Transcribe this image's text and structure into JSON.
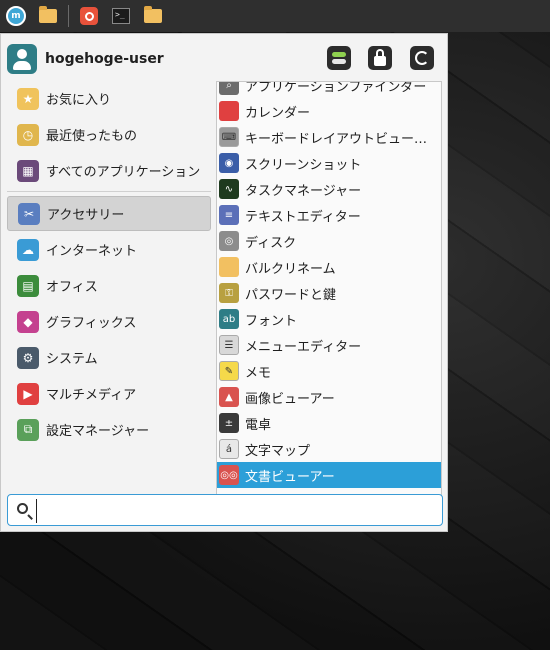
{
  "taskbar": {
    "items": [
      {
        "name": "menu-logo",
        "icon": "mint-logo-icon"
      },
      {
        "name": "files",
        "icon": "folder-icon"
      },
      {
        "name": "browser",
        "icon": "firefox-icon"
      },
      {
        "name": "terminal",
        "icon": "terminal-icon"
      },
      {
        "name": "folder",
        "icon": "folder-icon"
      }
    ]
  },
  "menu": {
    "user_name": "hogehoge-user",
    "header_buttons": {
      "settings_icon": "settings-toggle-icon",
      "lock_icon": "lock-icon",
      "logout_icon": "power-icon"
    },
    "categories": [
      {
        "label": "お気に入り",
        "icon": "favorites-icon",
        "color": "#f0c35c"
      },
      {
        "label": "最近使ったもの",
        "icon": "recent-icon",
        "color": "#e0b64d"
      },
      {
        "label": "すべてのアプリケーション",
        "icon": "grid-icon",
        "color": "#6b4a7a"
      },
      {
        "label": "アクセサリー",
        "icon": "scissors-icon",
        "color": "#5a7ec0",
        "active": true
      },
      {
        "label": "インターネット",
        "icon": "cloud-icon",
        "color": "#3a9bd5"
      },
      {
        "label": "オフィス",
        "icon": "office-icon",
        "color": "#3c8c3c"
      },
      {
        "label": "グラフィックス",
        "icon": "graphics-icon",
        "color": "#c4418f"
      },
      {
        "label": "システム",
        "icon": "gear-icon",
        "color": "#4a5a6a"
      },
      {
        "label": "マルチメディア",
        "icon": "play-icon",
        "color": "#e04040"
      },
      {
        "label": "設定マネージャー",
        "icon": "settings-icon",
        "color": "#5aa05a"
      }
    ],
    "apps": [
      {
        "label": "アプリケーションファインダー",
        "icon": "magnifier-icon",
        "color": "#6c6c6c"
      },
      {
        "label": "カレンダー",
        "icon": "calendar-icon",
        "color": "#e04040"
      },
      {
        "label": "キーボードレイアウトビュー…",
        "icon": "keyboard-icon",
        "color": "#9a9a9a"
      },
      {
        "label": "スクリーンショット",
        "icon": "camera-icon",
        "color": "#3b5ea8"
      },
      {
        "label": "タスクマネージャー",
        "icon": "pulse-icon",
        "color": "#1e3a1e"
      },
      {
        "label": "テキストエディター",
        "icon": "text-editor-icon",
        "color": "#5b6fb8"
      },
      {
        "label": "ディスク",
        "icon": "disk-icon",
        "color": "#8c8c8c"
      },
      {
        "label": "バルクリネーム",
        "icon": "folder-icon",
        "color": "#f2c061"
      },
      {
        "label": "パスワードと鍵",
        "icon": "key-icon",
        "color": "#b8a040"
      },
      {
        "label": "フォント",
        "icon": "font-icon",
        "color": "#2e7d86"
      },
      {
        "label": "メニューエディター",
        "icon": "menu-editor-icon",
        "color": "#d8d8d8"
      },
      {
        "label": "メモ",
        "icon": "notes-icon",
        "color": "#f5d94a"
      },
      {
        "label": "画像ビューアー",
        "icon": "image-viewer-icon",
        "color": "#d9534f"
      },
      {
        "label": "電卓",
        "icon": "calculator-icon",
        "color": "#3a3a3a"
      },
      {
        "label": "文字マップ",
        "icon": "character-map-icon",
        "color": "#e8e8e8"
      },
      {
        "label": "文書ビューアー",
        "icon": "document-viewer-icon",
        "color": "#d9534f",
        "selected": true
      }
    ],
    "search": {
      "value": "",
      "placeholder": "",
      "icon": "search-icon"
    }
  },
  "colors": {
    "accent": "#2c9fd8",
    "menu_bg": "#f3f3f3",
    "taskbar_bg": "#2f2f2f"
  }
}
